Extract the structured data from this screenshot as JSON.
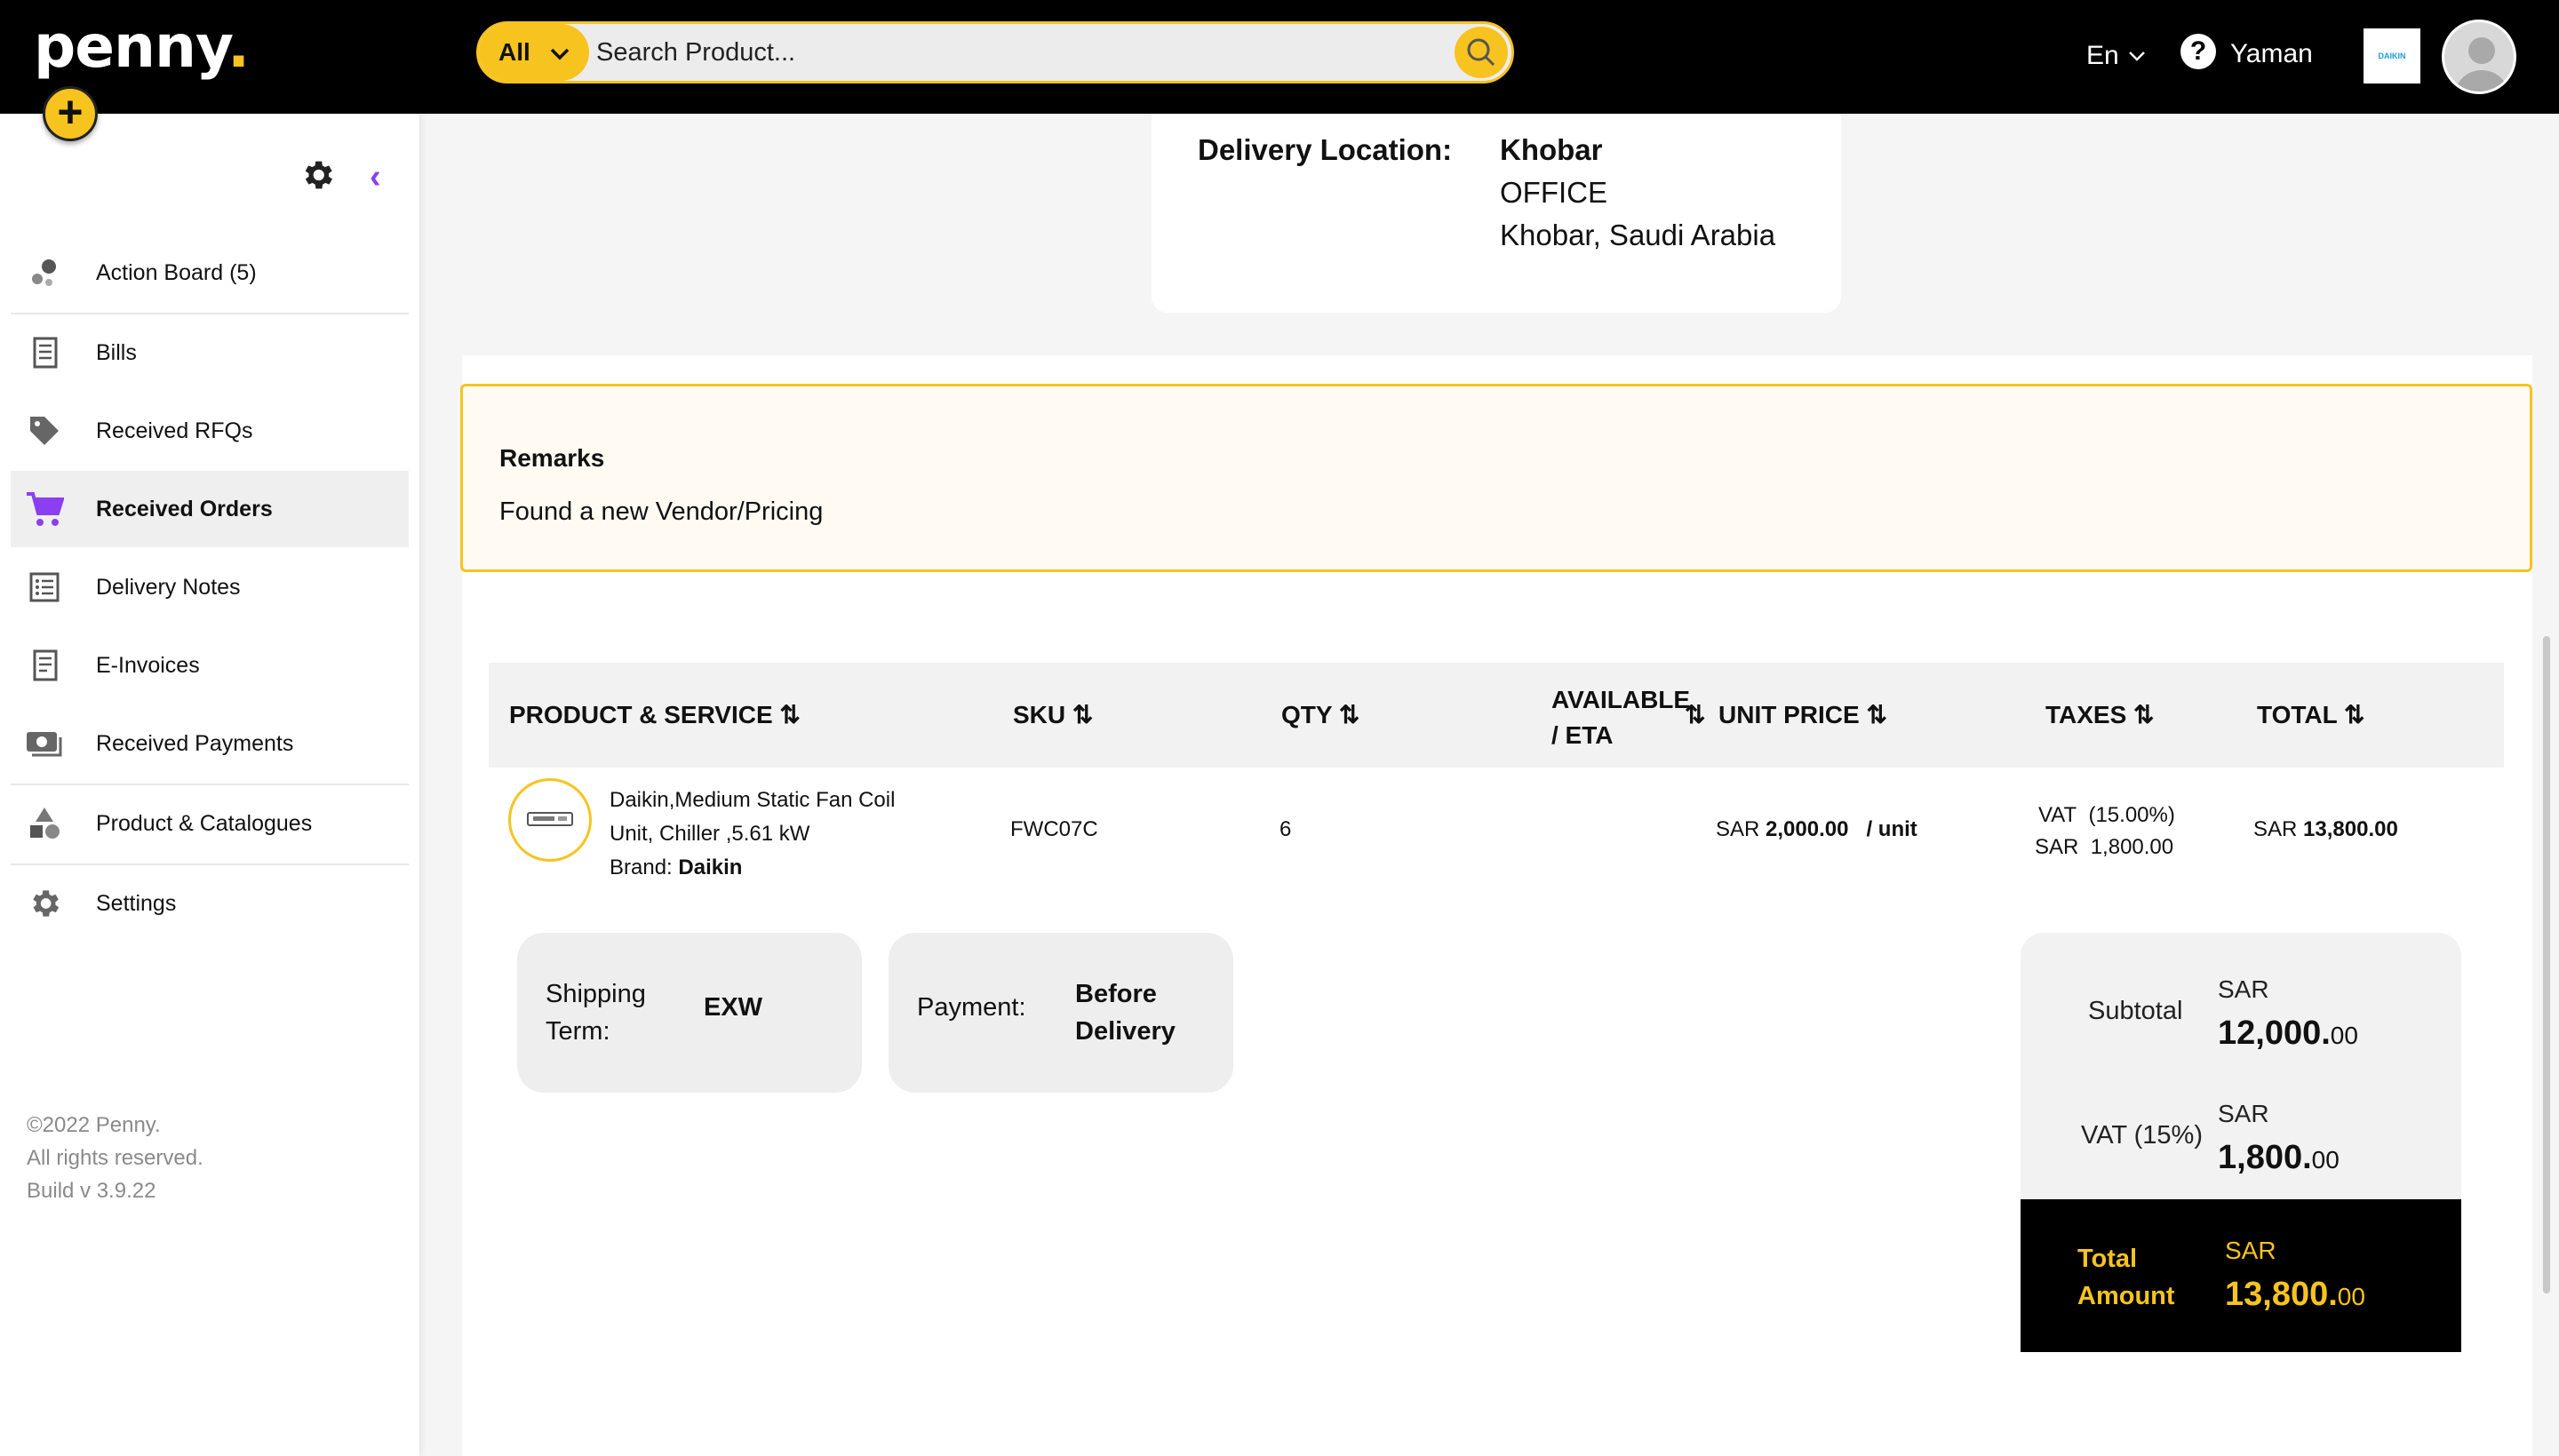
{
  "app": {
    "logo": "penny"
  },
  "header": {
    "search_scope": "All",
    "search_placeholder": "Search Product...",
    "language": "En",
    "username": "Yaman",
    "brand_logo_text": "DAIKIN"
  },
  "sidebar": {
    "items": [
      {
        "label": "Action Board (5)",
        "icon": "action-board-icon"
      },
      {
        "label": "Bills",
        "icon": "bills-icon"
      },
      {
        "label": "Received RFQs",
        "icon": "tag-icon"
      },
      {
        "label": "Received Orders",
        "icon": "cart-icon",
        "active": true
      },
      {
        "label": "Delivery Notes",
        "icon": "list-icon"
      },
      {
        "label": "E-Invoices",
        "icon": "invoice-icon"
      },
      {
        "label": "Received Payments",
        "icon": "payments-icon"
      },
      {
        "label": "Product & Catalogues",
        "icon": "shapes-icon"
      },
      {
        "label": "Settings",
        "icon": "gear-icon"
      }
    ],
    "footer": {
      "copyright": "©2022 Penny.",
      "rights": "All rights reserved.",
      "build": "Build v 3.9.22"
    }
  },
  "delivery": {
    "label": "Delivery Location:",
    "city": "Khobar",
    "type": "OFFICE",
    "address": "Khobar, Saudi Arabia"
  },
  "remarks": {
    "title": "Remarks",
    "text": "Found a new Vendor/Pricing"
  },
  "table": {
    "headers": {
      "product": "PRODUCT & SERVICE",
      "sku": "SKU",
      "qty": "QTY",
      "available_1": "AVAILABLE",
      "available_2": "/ ETA",
      "unit_price": "UNIT PRICE",
      "taxes": "TAXES",
      "total": "TOTAL"
    },
    "rows": [
      {
        "product_line1": "Daikin,Medium Static Fan Coil",
        "product_line2": "Unit, Chiller ,5.61 kW",
        "brand_label": "Brand:",
        "brand": "Daikin",
        "sku": "FWC07C",
        "qty": "6",
        "price_currency": "SAR",
        "price_value": "2,000.00",
        "price_unit": "/ unit",
        "tax_label": "VAT",
        "tax_rate": "(15.00%)",
        "tax_currency": "SAR",
        "tax_value": "1,800.00",
        "total_currency": "SAR",
        "total_value": "13,800.00"
      }
    ]
  },
  "terms": {
    "shipping_label_1": "Shipping",
    "shipping_label_2": "Term:",
    "shipping_value": "EXW",
    "payment_label": "Payment:",
    "payment_value_1": "Before",
    "payment_value_2": "Delivery"
  },
  "totals": {
    "subtotal_label": "Subtotal",
    "subtotal_currency": "SAR",
    "subtotal_main": "12,000.",
    "subtotal_cents": "00",
    "vat_label": "VAT (15%)",
    "vat_currency": "SAR",
    "vat_main": "1,800.",
    "vat_cents": "00",
    "total_label_1": "Total",
    "total_label_2": "Amount",
    "total_currency": "SAR",
    "total_main": "13,800.",
    "total_cents": "00"
  },
  "colors": {
    "accent": "#f7c31f",
    "purple": "#8b3ff0",
    "topbar": "#000000"
  }
}
